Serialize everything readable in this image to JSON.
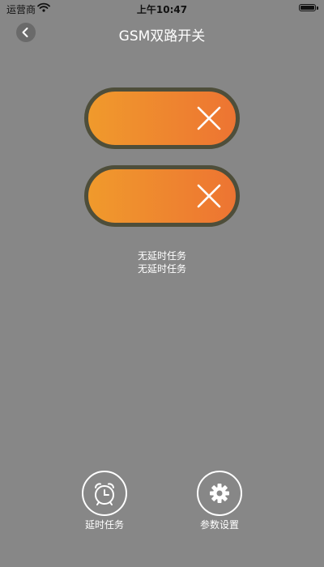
{
  "status_bar": {
    "carrier": "运营商",
    "time": "上午10:47"
  },
  "nav": {
    "title": "GSM双路开关",
    "back_icon": "chevron-left-icon"
  },
  "switches": [
    {
      "icon": "close-x-icon",
      "state": "off",
      "color_start": "#f09a2c",
      "color_end": "#ed7432",
      "border_color": "#4e4e3a"
    },
    {
      "icon": "close-x-icon",
      "state": "off",
      "color_start": "#f09a2c",
      "color_end": "#ed7432",
      "border_color": "#4e4e3a"
    }
  ],
  "tasks": {
    "line1": "无延时任务",
    "line2": "无延时任务"
  },
  "bottom": {
    "timer_label": "延时任务",
    "timer_icon": "alarm-clock-icon",
    "settings_label": "参数设置",
    "settings_icon": "gear-icon"
  },
  "colors": {
    "background": "#878787",
    "text": "#ffffff"
  }
}
